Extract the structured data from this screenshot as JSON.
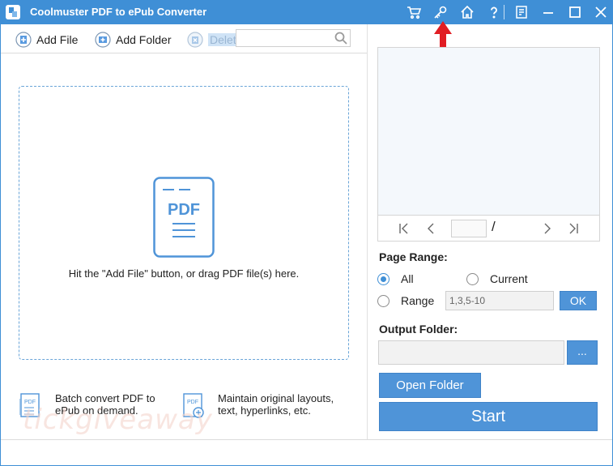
{
  "window": {
    "title": "Coolmuster PDF to ePub Converter",
    "accent_color": "#3f8fd6",
    "title_icons": [
      "cart-icon",
      "key-icon",
      "home-icon",
      "help-icon",
      "feedback-icon",
      "minimize-icon",
      "maximize-icon",
      "close-icon"
    ]
  },
  "toolbar": {
    "add_file": "Add File",
    "add_folder": "Add Folder",
    "delete": "Delete",
    "search_value": ""
  },
  "dropzone": {
    "doc_label": "PDF",
    "hint": "Hit the \"Add File\" button, or drag PDF file(s) here."
  },
  "features": {
    "batch": "Batch convert PDF to ePub on demand.",
    "layout": "Maintain original layouts, text, hyperlinks, etc."
  },
  "watermark": "tickgiveaway",
  "preview": {
    "page_value": "",
    "page_separator": "/"
  },
  "page_range": {
    "label": "Page Range:",
    "all": "All",
    "current": "Current",
    "range": "Range",
    "range_value": "1,3,5-10",
    "ok": "OK",
    "selected": "All"
  },
  "output": {
    "label": "Output Folder:",
    "path_value": "",
    "browse": "...",
    "open_folder": "Open Folder",
    "start": "Start"
  }
}
